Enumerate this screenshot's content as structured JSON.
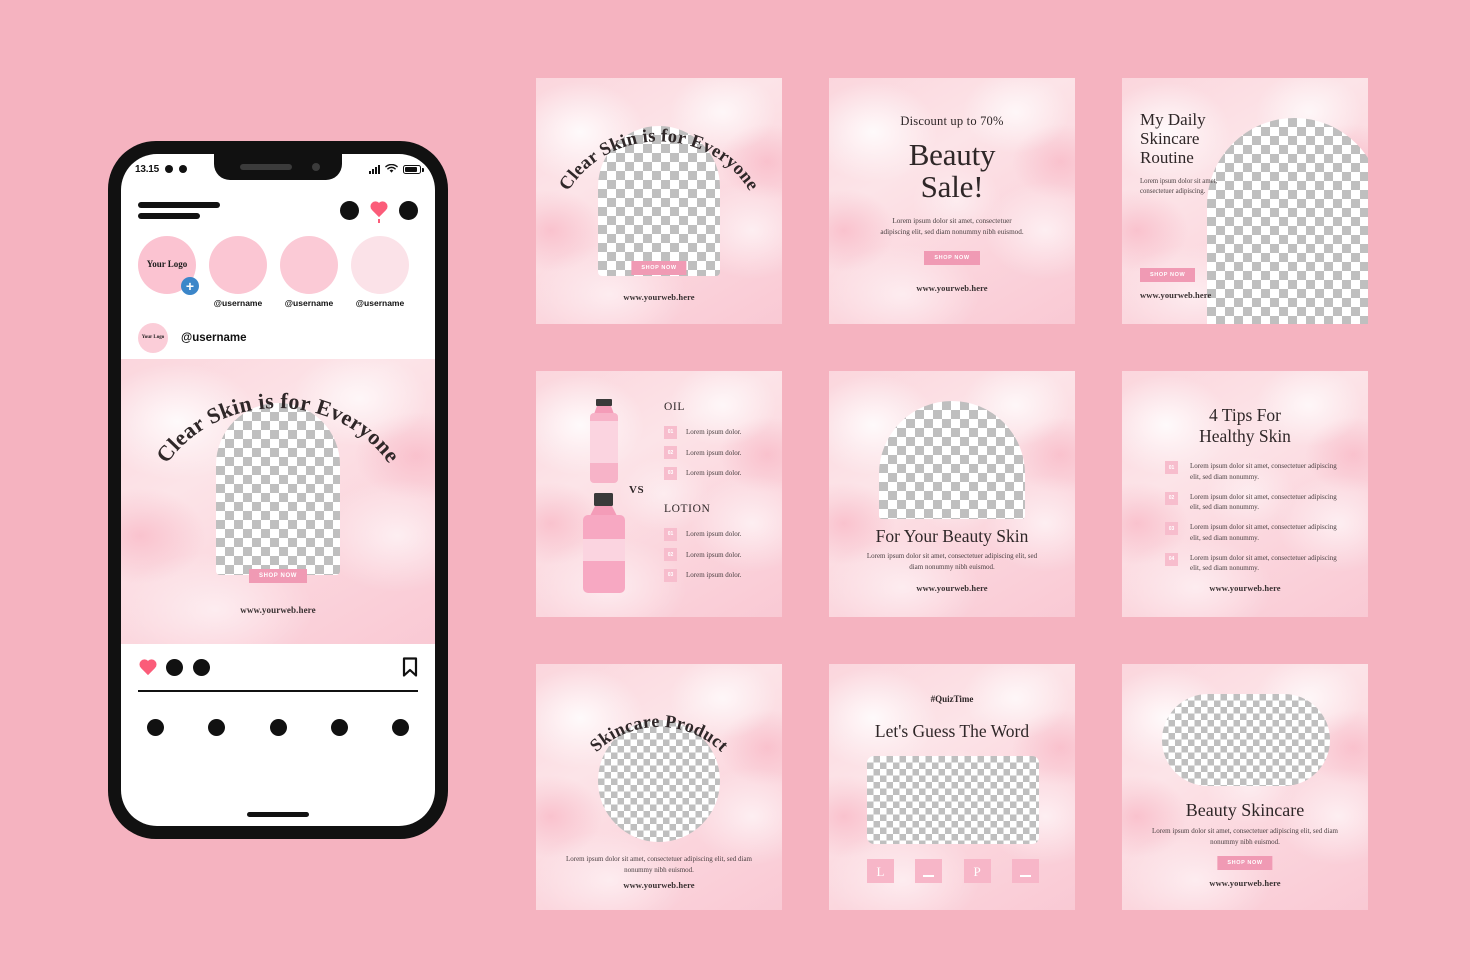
{
  "background_color": "#f5b3c0",
  "accent_pink": "#f09ab4",
  "text_dark": "#2f2728",
  "phone": {
    "status_bar": {
      "time": "13.15",
      "signal_icon": "signal-bars-icon",
      "wifi_icon": "wifi-icon",
      "battery_icon": "battery-icon"
    },
    "header": {
      "logo": "brand-logo-placeholder",
      "icons": [
        "add-post-icon",
        "heart-icon",
        "messenger-icon"
      ]
    },
    "stories": [
      {
        "label": "Your Logo",
        "username": "",
        "has_add_badge": true,
        "badge": "+"
      },
      {
        "label": "",
        "username": "@username",
        "has_add_badge": false
      },
      {
        "label": "",
        "username": "@username",
        "has_add_badge": false
      },
      {
        "label": "",
        "username": "@username",
        "has_add_badge": false
      }
    ],
    "post": {
      "avatar_label": "Your Logo",
      "username": "@username",
      "title": "Clear Skin is for Everyone",
      "cta": "SHOP NOW",
      "url": "www.yourweb.here"
    },
    "actions": {
      "like_icon": "heart-icon",
      "comment_icon": "comment-icon",
      "share_icon": "share-icon",
      "save_icon": "bookmark-icon"
    },
    "tabs": [
      "home-icon",
      "search-icon",
      "reels-icon",
      "shop-icon",
      "profile-icon"
    ]
  },
  "cards": [
    {
      "id": "card1",
      "name": "clear-skin-post",
      "curved_title": "Clear Skin is for Everyone",
      "cta": "SHOP NOW",
      "url": "www.yourweb.here"
    },
    {
      "id": "card2",
      "name": "beauty-sale-post",
      "eyebrow": "Discount up to 70%",
      "title_line1": "Beauty",
      "title_line2": "Sale!",
      "body": "Lorem ipsum dolor sit amet, consectetuer adipiscing elit, sed diam nonummy nibh euismod.",
      "cta": "SHOP NOW",
      "url": "www.yourweb.here"
    },
    {
      "id": "card3",
      "name": "daily-skincare-routine-post",
      "title_line1": "My Daily",
      "title_line2": "Skincare",
      "title_line3": "Routine",
      "body": "Lorem ipsum dolor sit amet, consectetuer adipiscing.",
      "cta": "SHOP NOW",
      "url": "www.yourweb.here"
    },
    {
      "id": "card4",
      "name": "oil-vs-lotion-post",
      "vs": "VS",
      "group_a": {
        "heading": "OIL",
        "items": [
          {
            "num": "01",
            "text": "Lorem ipsum dolor."
          },
          {
            "num": "02",
            "text": "Lorem ipsum dolor."
          },
          {
            "num": "03",
            "text": "Lorem ipsum dolor."
          }
        ]
      },
      "group_b": {
        "heading": "LOTION",
        "items": [
          {
            "num": "01",
            "text": "Lorem ipsum dolor."
          },
          {
            "num": "02",
            "text": "Lorem ipsum dolor."
          },
          {
            "num": "03",
            "text": "Lorem ipsum dolor."
          }
        ]
      }
    },
    {
      "id": "card5",
      "name": "for-your-beauty-skin-post",
      "title": "For Your Beauty Skin",
      "body": "Lorem ipsum dolor sit amet, consectetuer adipiscing elit, sed diam nonummy nibh euismod.",
      "url": "www.yourweb.here"
    },
    {
      "id": "card6",
      "name": "four-tips-healthy-skin-post",
      "title_line1": "4 Tips For",
      "title_line2": "Healthy Skin",
      "items": [
        {
          "num": "01",
          "text": "Lorem ipsum dolor sit amet, consectetuer adipiscing elit, sed diam nonummy."
        },
        {
          "num": "02",
          "text": "Lorem ipsum dolor sit amet, consectetuer adipiscing elit, sed diam nonummy."
        },
        {
          "num": "03",
          "text": "Lorem ipsum dolor sit amet, consectetuer adipiscing elit, sed diam nonummy."
        },
        {
          "num": "04",
          "text": "Lorem ipsum dolor sit amet, consectetuer adipiscing elit, sed diam nonummy."
        }
      ],
      "url": "www.yourweb.here"
    },
    {
      "id": "card7",
      "name": "skincare-product-post",
      "curved_title": "Skincare Product",
      "body": "Lorem ipsum dolor sit amet, consectetuer adipiscing elit, sed diam nonummy nibh euismod.",
      "url": "www.yourweb.here"
    },
    {
      "id": "card8",
      "name": "quiz-guess-the-word-post",
      "hashtag": "#QuizTime",
      "title": "Let's Guess The Word",
      "tiles": [
        "L",
        "",
        "P",
        ""
      ]
    },
    {
      "id": "card9",
      "name": "beauty-skincare-post",
      "title": "Beauty Skincare",
      "body": "Lorem ipsum dolor sit amet, consectetuer adipiscing elit, sed diam nonummy nibh euismod.",
      "cta": "SHOP NOW",
      "url": "www.yourweb.here"
    }
  ]
}
